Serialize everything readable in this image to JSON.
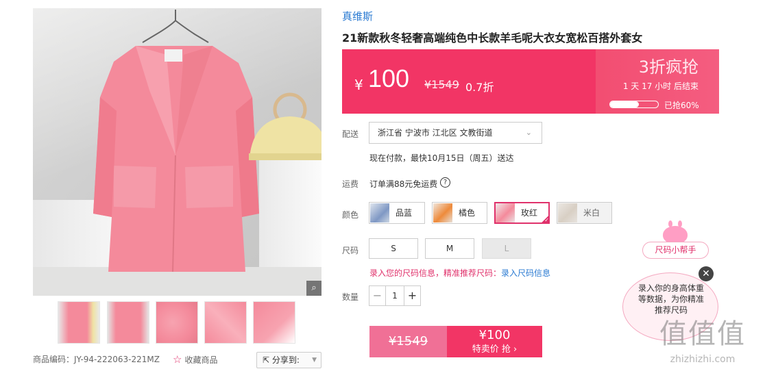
{
  "colors": {
    "accent": "#f23565",
    "link": "#2a7ad2",
    "pink_text": "#e0316b"
  },
  "product": {
    "brand": "真维斯",
    "title": "21新款秋冬轻奢高端纯色中长款羊毛呢大衣女宽松百搭外套女",
    "code_label": "商品编码：JY-94-222063-221MZ",
    "favorite_label": "收藏商品",
    "share_label": "分享到:"
  },
  "price_panel": {
    "currency": "¥",
    "price": "100",
    "original_price": "¥1549",
    "discount": "0.7折",
    "promo_title": "3折疯抢",
    "countdown": "1 天 17 小时 后结束",
    "sold_progress": 0.6,
    "sold_label": "已抢60%"
  },
  "delivery": {
    "label": "配送",
    "address": "浙江省 宁波市 江北区 文教街道",
    "note": "现在付款，最快10月15日（周五）送达"
  },
  "shipping": {
    "label": "运费",
    "text": "订单满88元免运费",
    "help_icon": "question-circle-icon"
  },
  "color": {
    "label": "颜色",
    "options": [
      {
        "name": "品蓝",
        "selected": false
      },
      {
        "name": "橘色",
        "selected": false
      },
      {
        "name": "玫红",
        "selected": true
      },
      {
        "name": "米白",
        "selected": false
      }
    ]
  },
  "size": {
    "label": "尺码",
    "options": [
      {
        "name": "S",
        "available": true
      },
      {
        "name": "M",
        "available": true
      },
      {
        "name": "L",
        "available": false
      }
    ],
    "hint": "录入您的尺码信息，精准推荐尺码：",
    "hint_link": "录入尺码信息"
  },
  "quantity": {
    "label": "数量",
    "value": "1",
    "minus": "−",
    "plus": "+"
  },
  "buy": {
    "original_price": "¥1549",
    "price": "¥100",
    "action": "特卖价 抢 ›"
  },
  "helper": {
    "tag": "尺码小帮手",
    "tip": "录入你的身高体重等数据，为你精准推荐尺码",
    "close": "✕"
  },
  "icons": {
    "zoom": "magnifier-icon",
    "favorite": "star-icon",
    "share": "share-icon"
  },
  "watermark": {
    "big": "值值值",
    "small": "zhizhizhi.com"
  }
}
